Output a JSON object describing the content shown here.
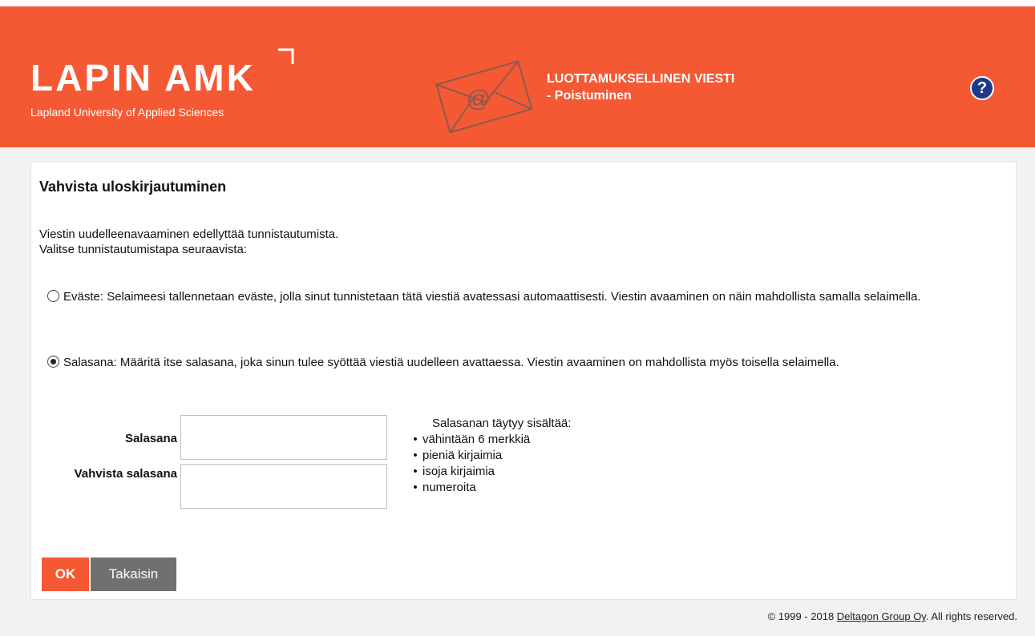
{
  "header": {
    "logo_title": "LAPIN AMK",
    "logo_subtitle": "Lapland University of Applied Sciences",
    "message_title_line1": "LUOTTAMUKSELLINEN VIESTI",
    "message_title_line2": "- Poistuminen",
    "help_label": "?",
    "envelope_icon": "envelope-at-icon"
  },
  "panel": {
    "title": "Vahvista uloskirjautuminen",
    "intro_line1": "Viestin uudelleenavaaminen edellyttää tunnistautumista.",
    "intro_line2": "Valitse tunnistautumistapa seuraavista:",
    "options": [
      {
        "text": "Eväste: Selaimeesi tallennetaan eväste, jolla sinut tunnistetaan tätä viestiä avatessasi automaattisesti. Viestin avaaminen on näin mahdollista samalla selaimella.",
        "selected": false
      },
      {
        "text": "Salasana: Määritä itse salasana, joka sinun tulee syöttää viestiä uudelleen avattaessa. Viestin avaaminen on mahdollista myös toisella selaimella.",
        "selected": true
      }
    ],
    "password_label": "Salasana",
    "confirm_label": "Vahvista salasana",
    "password_value": "",
    "confirm_value": "",
    "requirements_title": "Salasanan täytyy sisältää:",
    "requirements": [
      "vähintään 6 merkkiä",
      "pieniä kirjaimia",
      "isoja kirjaimia",
      "numeroita"
    ],
    "ok_label": "OK",
    "back_label": "Takaisin"
  },
  "footer": {
    "prefix": "© 1999 - 2018 ",
    "company_link": "Deltagon Group Oy",
    "suffix": ". All rights reserved."
  },
  "colors": {
    "brand": "#f55933",
    "help_button": "#1b3a8c",
    "back_button": "#707070"
  }
}
